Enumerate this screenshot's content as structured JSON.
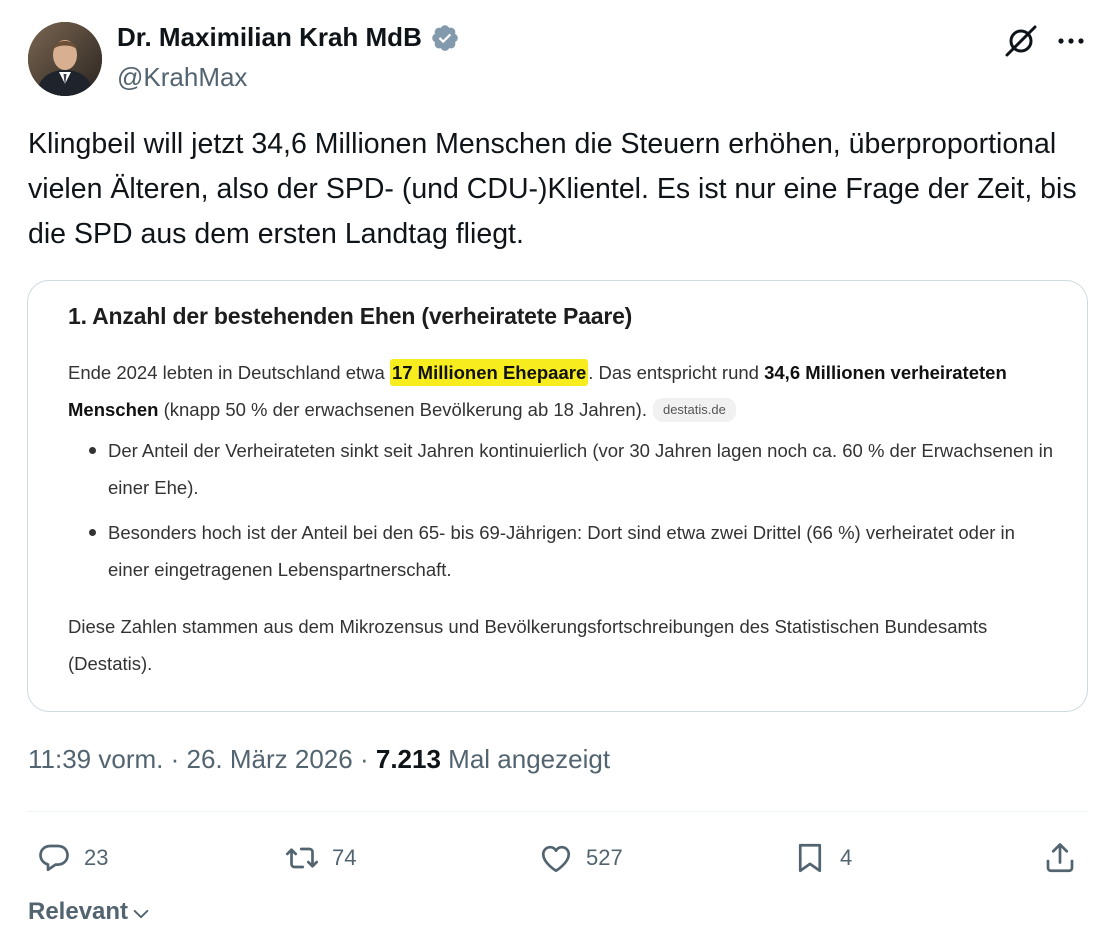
{
  "author": {
    "name": "Dr. Maximilian Krah MdB",
    "handle": "@KrahMax"
  },
  "tweet": {
    "text": "Klingbeil will jetzt 34,6 Millionen Menschen die Steuern erhöhen, überproportional vielen Älteren, also der SPD- (und CDU-)Klientel. Es ist nur eine Frage der Zeit, bis die SPD aus dem ersten Landtag fliegt."
  },
  "media": {
    "heading": "1. Anzahl der bestehenden Ehen (verheiratete Paare)",
    "para_part1": "Ende 2024 lebten in Deutschland etwa ",
    "para_highlight": "17 Millionen Ehepaare",
    "para_part2": ". Das entspricht rund ",
    "para_bold": "34,6 Millionen verheirateten Menschen",
    "para_part3": " (knapp 50 % der erwachsenen Bevölkerung ab 18 Jahren).",
    "source_chip": "destatis.de",
    "bullets": [
      "Der Anteil der Verheirateten sinkt seit Jahren kontinuierlich (vor 30 Jahren lagen noch ca. 60 % der Erwachsenen in einer Ehe).",
      "Besonders hoch ist der Anteil bei den 65- bis 69-Jährigen: Dort sind etwa zwei Drittel (66 %) verheiratet oder in einer eingetragenen Lebenspartnerschaft."
    ],
    "footer": "Diese Zahlen stammen aus dem Mikrozensus und Bevölkerungsfortschreibungen des Statistischen Bundesamts (Destatis)."
  },
  "meta": {
    "time": "11:39 vorm.",
    "separator": "·",
    "date": "26. März 2026",
    "views_count": "7.213",
    "views_label": "Mal angezeigt"
  },
  "actions": {
    "replies": "23",
    "reposts": "74",
    "likes": "527",
    "bookmarks": "4"
  },
  "sort": {
    "label": "Relevant"
  },
  "colors": {
    "verified": "#829aab",
    "highlight": "#f7ec1d",
    "muted": "#536471"
  }
}
